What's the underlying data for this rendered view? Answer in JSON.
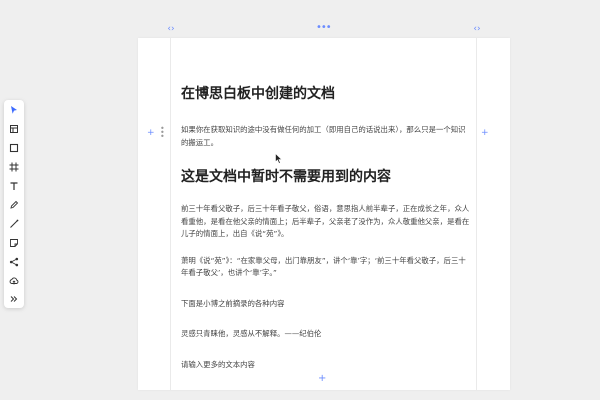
{
  "document": {
    "title": "在博思白板中创建的文档",
    "paragraphs": [
      "如果你在获取知识的途中没有做任何的加工（即用自己的话说出来），那么只是一个知识的搬运工。",
      "前三十年看父敬子，后三十年看子敬父，俗语，意思指人前半辈子，正在成长之年，众人看重他，是看在他父亲的情面上；后半辈子，父亲老了没作为，众人敬重他父亲，是看在儿子的情面上，出自《说“苑”》。",
      "萧明《说“苑”》：“在家靠父母，出门靠朋友”，讲个‘靠’字；‘前三十年看父敬子，后三十年看子敬父’，也讲个‘靠’字。”",
      "下面是小博之前摘录的各种内容",
      "灵感只青睐他，灵感从不解释。——纪伯伦",
      "请输入更多的文本内容"
    ],
    "heading2": "这是文档中暂时不需要用到的内容"
  },
  "toolbar": {
    "tools": [
      {
        "name": "select-tool",
        "icon": "cursor-arrow-icon",
        "active": true
      },
      {
        "name": "frame-tool",
        "icon": "frame-icon"
      },
      {
        "name": "shape-tool",
        "icon": "square-icon"
      },
      {
        "name": "crop-tool",
        "icon": "hash-frame-icon"
      },
      {
        "name": "text-tool",
        "icon": "text-t-icon"
      },
      {
        "name": "pen-tool",
        "icon": "pen-icon"
      },
      {
        "name": "line-tool",
        "icon": "line-icon"
      },
      {
        "name": "sticky-note-tool",
        "icon": "sticky-note-icon"
      },
      {
        "name": "mindmap-tool",
        "icon": "share-nodes-icon"
      },
      {
        "name": "upload-tool",
        "icon": "cloud-upload-icon"
      },
      {
        "name": "more-tools",
        "icon": "double-chevron-right-icon"
      }
    ]
  },
  "colors": {
    "accent": "#6b8cff",
    "active_tool": "#3d6bff",
    "canvas": "#efefef",
    "document": "#ffffff"
  }
}
